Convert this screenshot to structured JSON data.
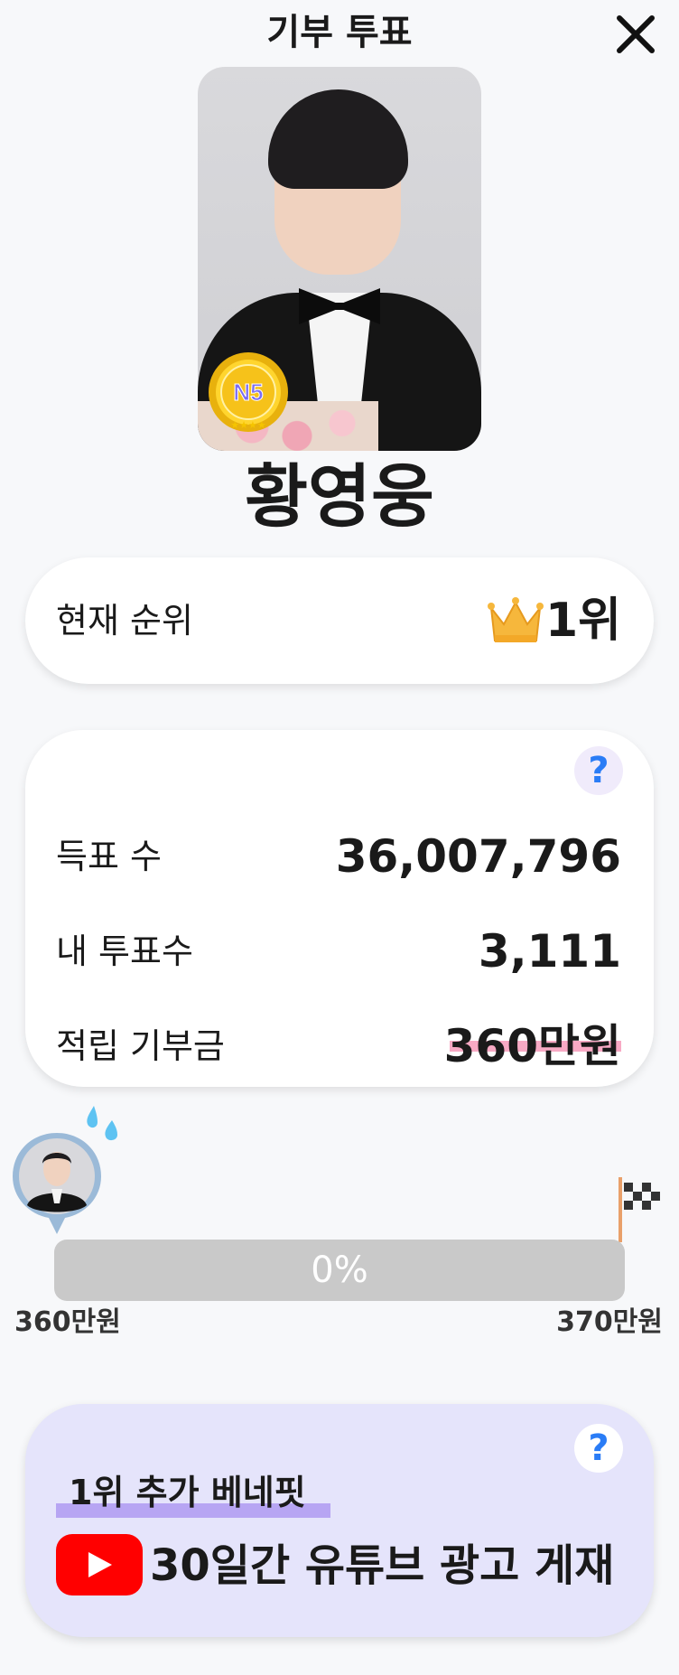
{
  "header": {
    "title": "기부 투표",
    "close_icon": "close-icon"
  },
  "profile": {
    "name": "황영웅",
    "badge": {
      "text": "N5",
      "stars": "★★★★"
    }
  },
  "rank": {
    "label": "현재 순위",
    "value": "1위",
    "icon": "crown-icon"
  },
  "stats": {
    "help": "?",
    "rows": [
      {
        "label": "득표 수",
        "value": "36,007,796"
      },
      {
        "label": "내 투표수",
        "value": "3,111"
      },
      {
        "label": "적립 기부금",
        "value": "360만원"
      }
    ]
  },
  "progress": {
    "percent_text": "0%",
    "percent": 0,
    "start_label": "360만원",
    "end_label": "370만원"
  },
  "benefit": {
    "help": "?",
    "label": "1위 추가 베네핏",
    "text": "30일간 유튜브 광고 게재",
    "icon": "youtube-icon"
  },
  "colors": {
    "accent_purple": "#b7a5f3",
    "benefit_bg": "#e5e4fb",
    "underline_pink": "#f7a9c4",
    "help_blue": "#2a7cf6",
    "youtube_red": "#ff0000"
  }
}
